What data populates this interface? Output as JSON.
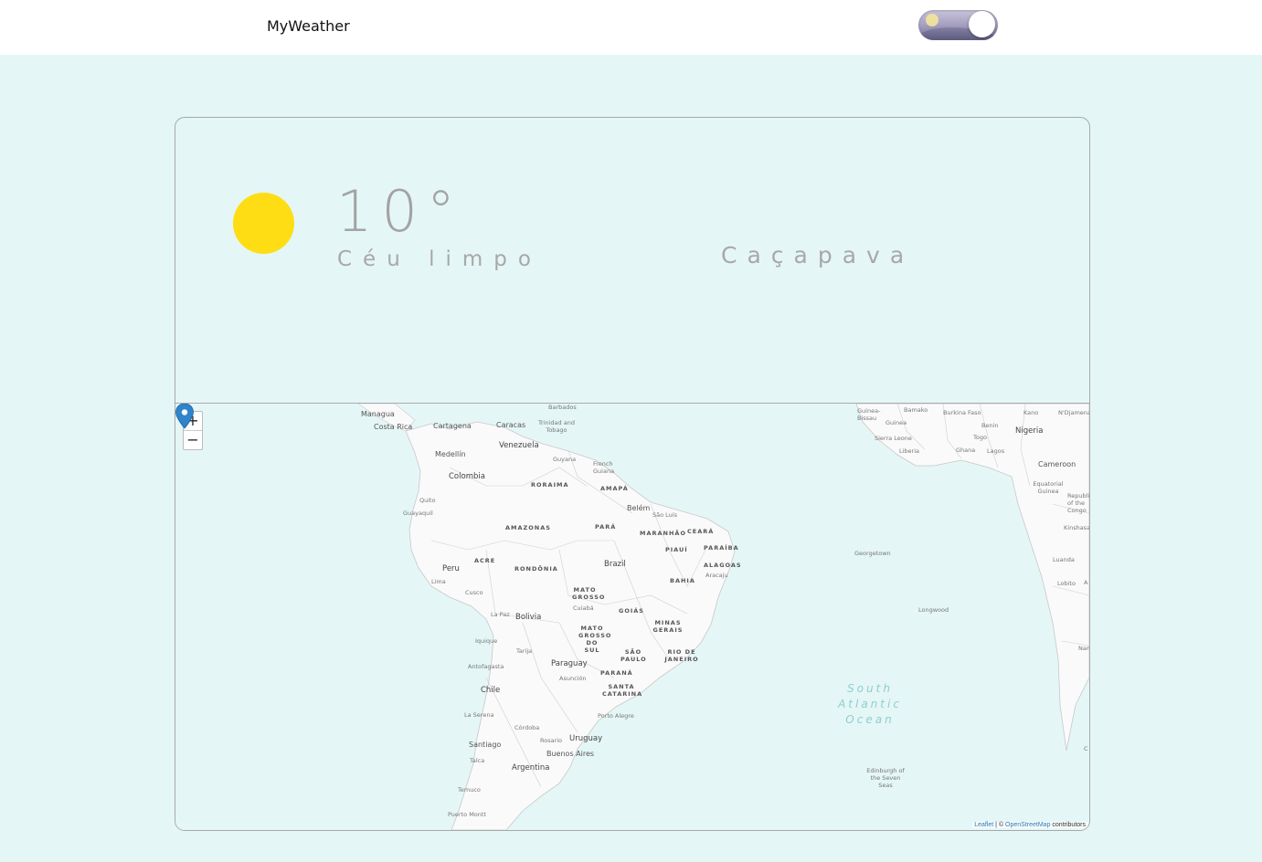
{
  "header": {
    "brand": "MyWeather"
  },
  "weather": {
    "temperature": "10°",
    "description": "Céu limpo",
    "city": "Caçapava",
    "icon": "sun-icon"
  },
  "map": {
    "zoom_in": "+",
    "zoom_out": "−",
    "attribution": {
      "leaflet": "Leaflet",
      "sep": " | © ",
      "osm": "OpenStreetMap",
      "suffix": " contributors"
    },
    "labels": {
      "managua": "Managua",
      "costa_rica": "Costa Rica",
      "cartagena": "Cartagena",
      "caracas": "Caracas",
      "trinidad": "Trinidad and Tobago",
      "barbados": "Barbados",
      "venezuela": "Venezuela",
      "medellin": "Medellín",
      "guyana": "Guyana",
      "french_guiana": "French Guiana",
      "colombia": "Colombia",
      "roraima": "RORAIMA",
      "amapa": "AMAPÁ",
      "quito": "Quito",
      "guayaquil": "Guayaquil",
      "belem": "Belém",
      "sao_luis": "São Luís",
      "amazonas": "AMAZONAS",
      "para": "PARÁ",
      "maranhao": "MARANHÃO",
      "ceara": "CEARÁ",
      "piaui": "PIAUÍ",
      "paraiba": "PARAÍBA",
      "peru": "Peru",
      "acre": "ACRE",
      "rondonia": "RONDÔNIA",
      "brazil": "Brazil",
      "alagoas": "ALAGOAS",
      "aracaju": "Aracaju",
      "lima": "Lima",
      "bahia": "BAHIA",
      "mato_grosso": "MATO GROSSO",
      "cusco": "Cusco",
      "cuiaba": "Cuiabá",
      "goias": "GOIÁS",
      "la_paz": "La Paz",
      "bolivia": "Bolivia",
      "minas": "MINAS GERAIS",
      "ms": "MATO GROSSO DO SUL",
      "iquique": "Iquique",
      "tarija": "Tarija",
      "sao_paulo": "SÃO PAULO",
      "rio": "RIO DE JANEIRO",
      "antofagasta": "Antofagasta",
      "paraguay": "Paraguay",
      "parana": "PARANÁ",
      "asuncion": "Asunción",
      "chile": "Chile",
      "santa_catarina": "SANTA CATARINA",
      "la_serena": "La Serena",
      "porto_alegre": "Porto Alegre",
      "cordoba": "Córdoba",
      "rosario": "Rosario",
      "uruguay": "Uruguay",
      "santiago": "Santiago",
      "buenos_aires": "Buenos Aires",
      "talca": "Talca",
      "argentina": "Argentina",
      "temuco": "Temuco",
      "puerto_montt": "Puerto Montt",
      "guinea_bissau": "Guinea-Bissau",
      "guinea": "Guinea",
      "bamako": "Bamako",
      "burkina": "Burkina Faso",
      "kano": "Kano",
      "ndjamena": "N'Djamena",
      "benin": "Benin",
      "nigeria": "Nigeria",
      "sierra_leone": "Sierra Leone",
      "togo": "Togo",
      "liberia": "Liberia",
      "ghana": "Ghana",
      "lagos": "Lagos",
      "cameroon": "Cameroon",
      "eq_guinea": "Equatorial Guinea",
      "republic_congo": "Republic of the Congo",
      "kinshasa": "Kinshasa",
      "georgetown": "Georgetown",
      "luanda": "Luanda",
      "lobito": "Lobito",
      "longwood": "Longwood",
      "ocean": "South Atlantic Ocean",
      "edinburgh": "Edinburgh of the Seven Seas",
      "nam": "Nam",
      "a_mark": "A",
      "c_mark": "C"
    }
  }
}
